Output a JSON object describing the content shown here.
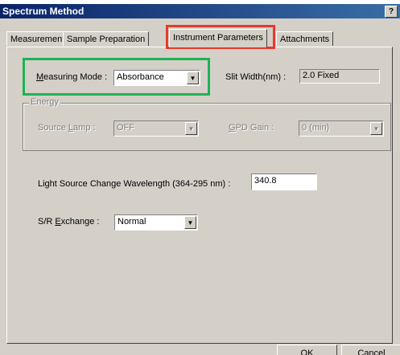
{
  "window": {
    "title": "Spectrum Method",
    "help_label": "?"
  },
  "tabs": [
    {
      "label": "Measurement",
      "active": false
    },
    {
      "label": "Sample Preparation",
      "active": false
    },
    {
      "label": "Instrument Parameters",
      "active": true
    },
    {
      "label": "Attachments",
      "active": false
    }
  ],
  "measuring_mode": {
    "label_prefix": "M",
    "label_rest": "easuring Mode :",
    "value": "Absorbance"
  },
  "slit_width": {
    "label": "Slit Width(nm) :",
    "value": "2.0 Fixed"
  },
  "energy": {
    "group_label": "Energy",
    "source_lamp": {
      "label_prefix": "Source ",
      "label_underline": "L",
      "label_rest": "amp :",
      "value": "OFF"
    },
    "gpd_gain": {
      "label_underline": "G",
      "label_rest": "PD Gain :",
      "value": "0 (min)"
    }
  },
  "light_source_change": {
    "label": "Light Source Change Wavelength (364-295 nm) :",
    "value": "340.8"
  },
  "sr_exchange": {
    "label_prefix": "S/R ",
    "label_underline": "E",
    "label_rest": "xchange :",
    "value": "Normal"
  },
  "buttons": {
    "ok": "OK",
    "cancel": "Cancel"
  },
  "highlights": {
    "tab_color": "#e8392b",
    "field_color": "#1fb255"
  }
}
